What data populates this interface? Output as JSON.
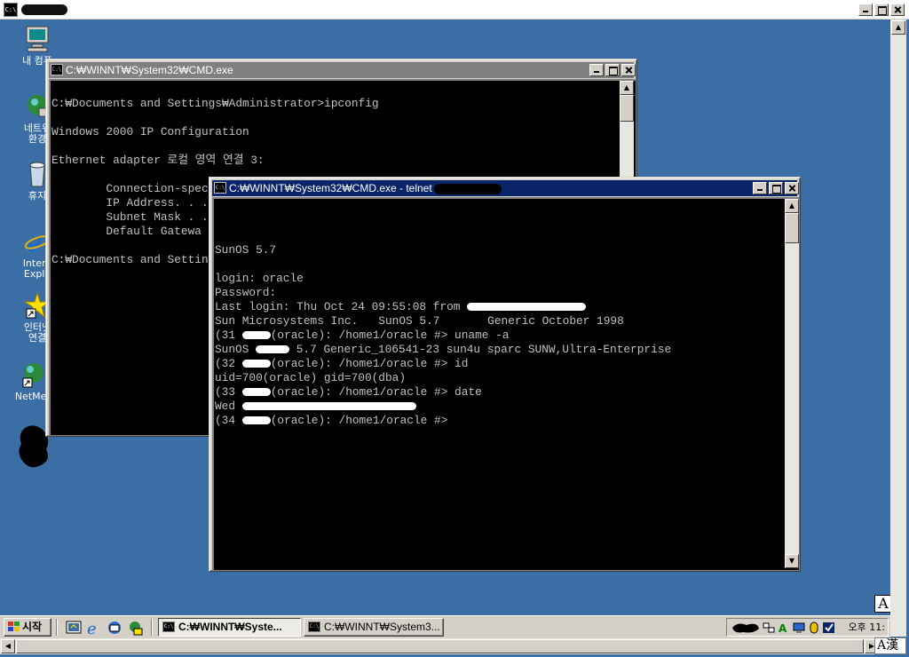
{
  "desktop": {
    "icons": [
      {
        "label": "내 컴퓨",
        "name": "my-computer"
      },
      {
        "label": "네트워\n환경",
        "name": "network"
      },
      {
        "label": "휴지",
        "name": "recycle-bin"
      },
      {
        "label": "Intern\nExplo",
        "name": "internet-explorer"
      },
      {
        "label": "인터넷\n연결",
        "name": "internet-connection"
      },
      {
        "label": "NetMee",
        "name": "netmeeting"
      }
    ]
  },
  "cmd_window": {
    "title": "C:₩WINNT₩System32₩CMD.exe",
    "lines": [
      "",
      "C:₩Documents and Settings₩Administrator>ipconfig",
      "",
      "Windows 2000 IP Configuration",
      "",
      "Ethernet adapter 로컬 영역 연결 3:",
      "",
      "        Connection-spec",
      "        IP Address. . .",
      "        Subnet Mask . .",
      "        Default Gatewa",
      "",
      "C:₩Documents and Settin"
    ]
  },
  "telnet_window": {
    "title": "C:₩WINNT₩System32₩CMD.exe - telnet",
    "lines": {
      "sunos": "SunOS 5.7",
      "login": "login: oracle",
      "password": "Password:",
      "last_login": "Last login: Thu Oct 24 09:55:08 from ",
      "sun_micro": "Sun Microsystems Inc.   SunOS 5.7       Generic October 1998",
      "p31_a": "(31 ",
      "p31_b": "(oracle): /home1/oracle #> uname -a",
      "uname_a": "SunOS ",
      "uname_b": " 5.7 Generic_106541-23 sun4u sparc SUNW,Ultra-Enterprise",
      "p32_a": "(32 ",
      "p32_b": "(oracle): /home1/oracle #> id",
      "id_out": "uid=700(oracle) gid=700(dba)",
      "p33_a": "(33 ",
      "p33_b": "(oracle): /home1/oracle #> date",
      "date_out": "Wed ",
      "p34_a": "(34 ",
      "p34_b": "(oracle): /home1/oracle #>"
    }
  },
  "taskbar": {
    "start_label": "시작",
    "tasks": [
      {
        "label": "C:₩WINNT₩Syste...",
        "active": true
      },
      {
        "label": "C:₩WINNT₩System3...",
        "active": false
      }
    ],
    "clock": "오후 11:"
  },
  "ime": {
    "box": "A",
    "bar": "A漢"
  },
  "colors": {
    "desktop": "#3a6ea5",
    "titlebar_active": "#0a246a",
    "titlebar_inactive": "#808080",
    "console_text": "#c0c0c0",
    "console_bg": "#000000"
  }
}
